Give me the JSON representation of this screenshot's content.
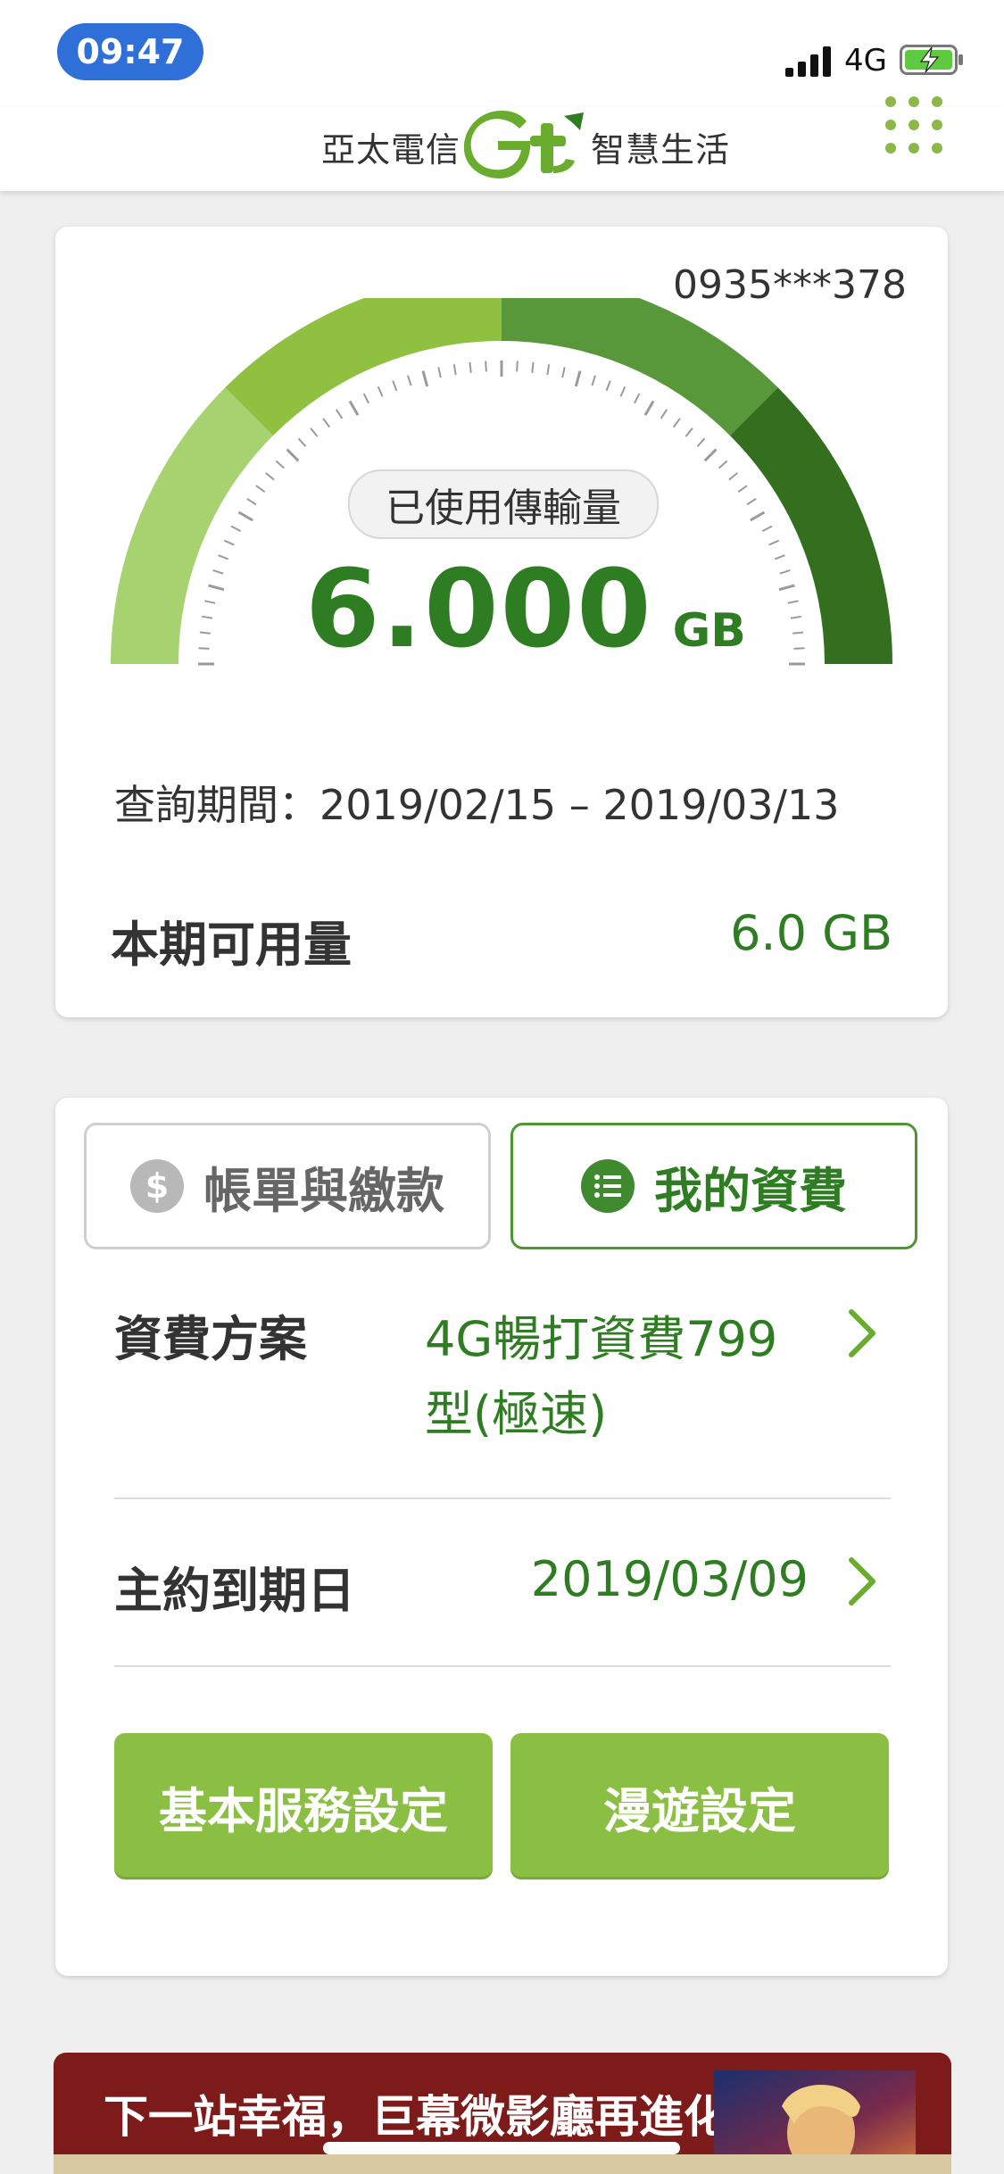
{
  "status_bar": {
    "time": "09:47",
    "network": "4G",
    "battery_icon": "battery-charging-icon",
    "signal_icon": "signal-icon"
  },
  "header": {
    "brand_left": "亞太電信",
    "brand_logo": "Gt",
    "brand_right": "智慧生活",
    "menu_icon": "grid-menu-icon"
  },
  "usage": {
    "phone": "0935***378",
    "used_label": "已使用傳輸量",
    "used_value": "6.000",
    "used_unit": "GB",
    "period": "查詢期間：2019/02/15 – 2019/03/13",
    "available_label": "本期可用量",
    "available_value": "6.0 GB",
    "gauge_colors": [
      "#a6d36f",
      "#8fc040",
      "#58983a",
      "#336f1e"
    ]
  },
  "plan_card": {
    "tabs": [
      {
        "label": "帳單與繳款",
        "icon": "dollar-icon",
        "active": false
      },
      {
        "label": "我的資費",
        "icon": "list-icon",
        "active": true
      }
    ],
    "rows": [
      {
        "label": "資費方案",
        "value_line1": "4G暢打資費799",
        "value_line2": "型(極速)"
      },
      {
        "label": "主約到期日",
        "value_line1": "2019/03/09"
      }
    ],
    "buttons": [
      "基本服務設定",
      "漫遊設定"
    ]
  },
  "banner": {
    "text": "下一站幸福，巨幕微影廳再進化"
  },
  "colors": {
    "accent_green": "#2f7d22",
    "button_green": "#8bbf43",
    "time_pill_blue": "#2f6fd8"
  }
}
